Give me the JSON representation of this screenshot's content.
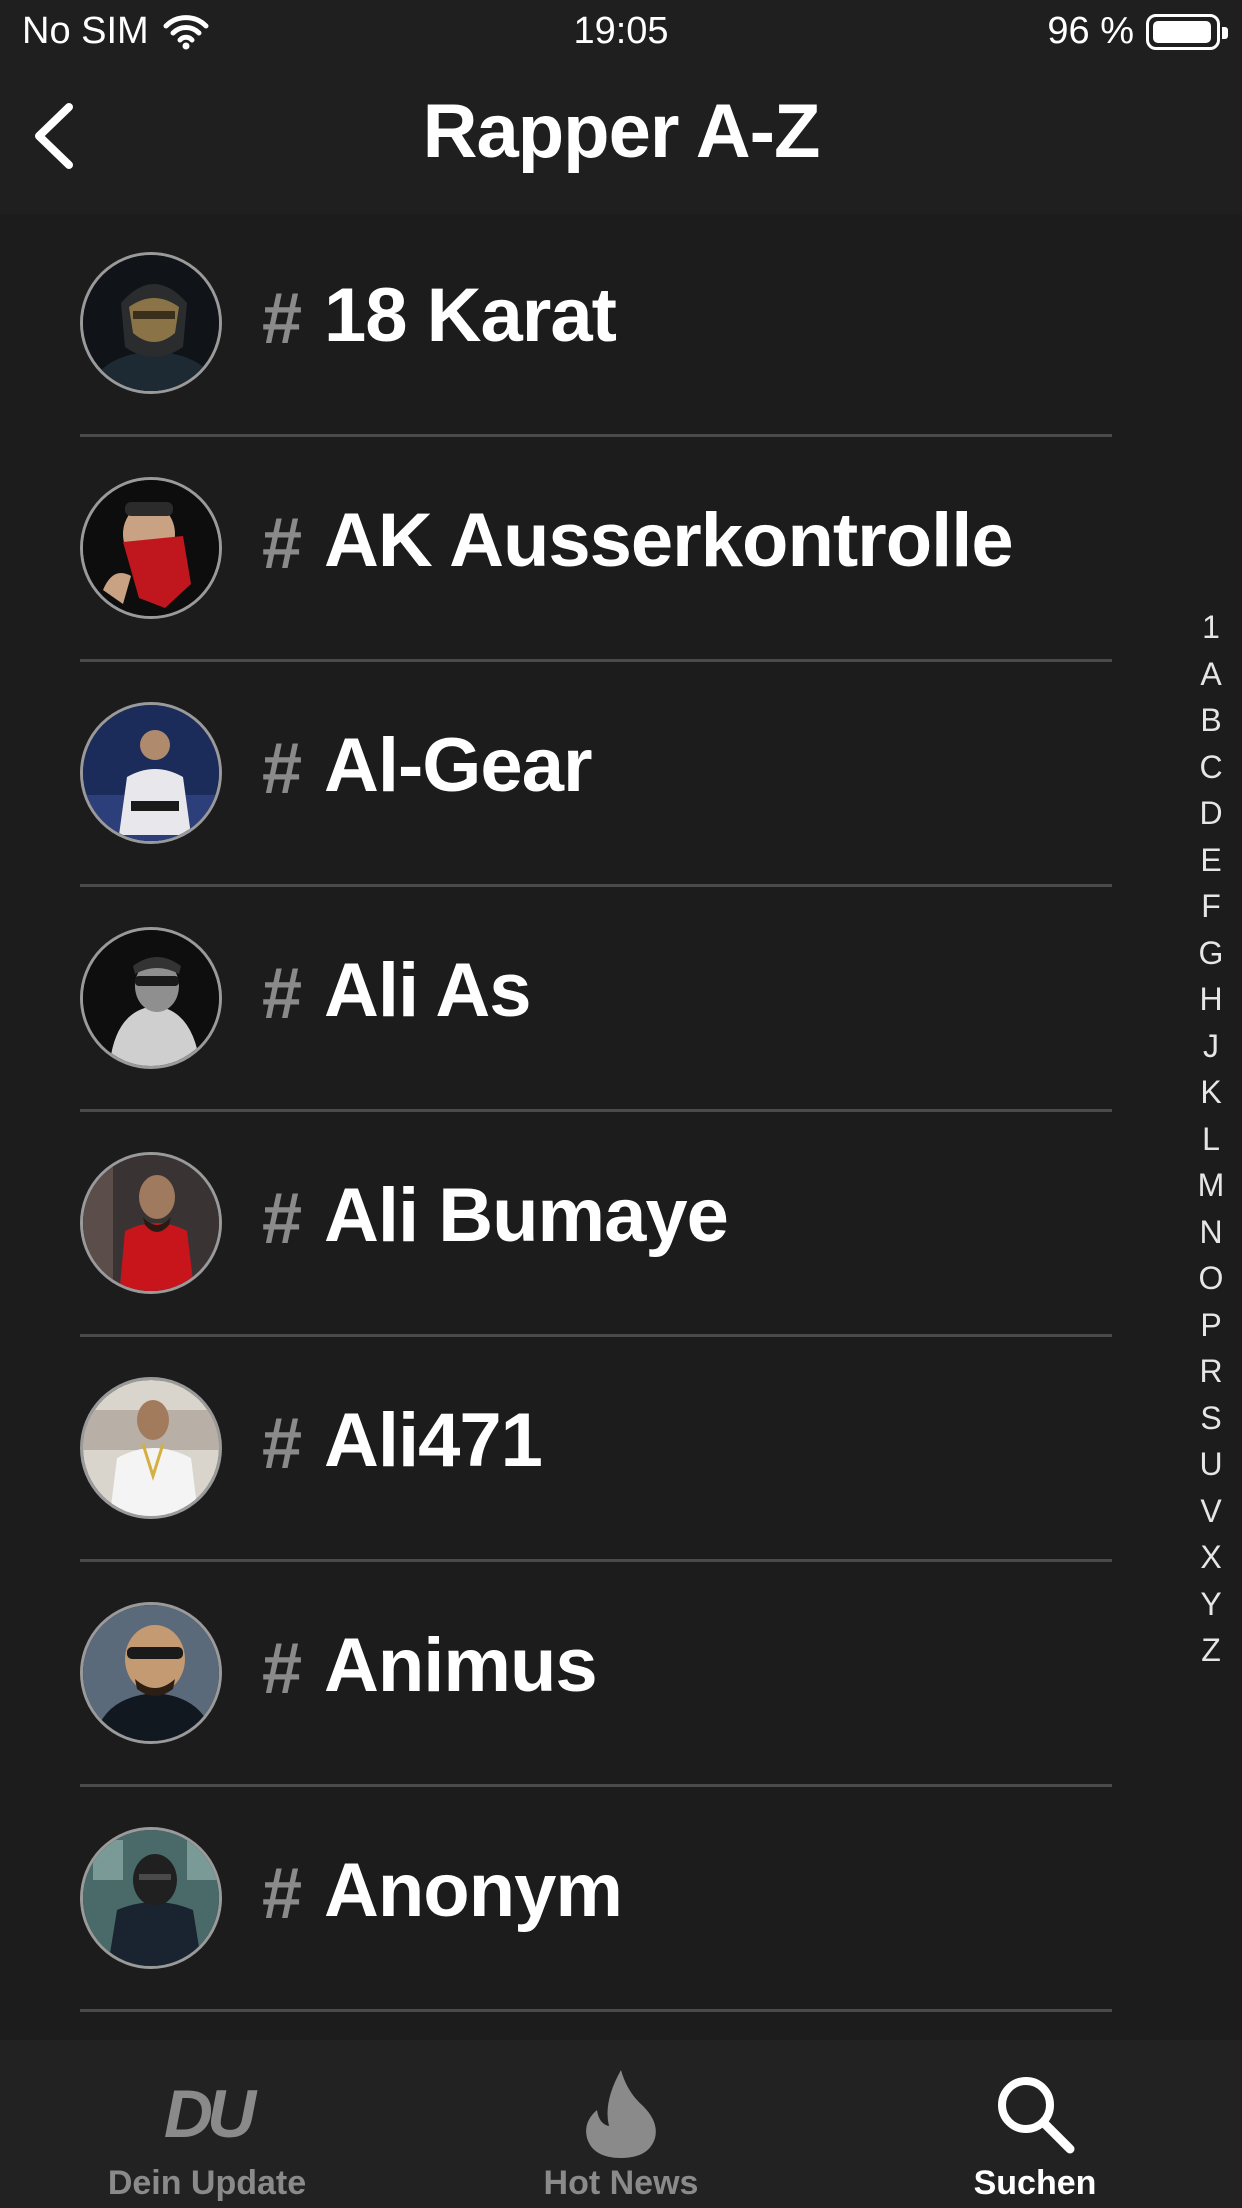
{
  "status": {
    "carrier": "No SIM",
    "time": "19:05",
    "battery": "96 %"
  },
  "nav": {
    "title": "Rapper A-Z"
  },
  "rows": [
    {
      "hash": "#",
      "name": "18 Karat"
    },
    {
      "hash": "#",
      "name": "AK Ausserkontrolle"
    },
    {
      "hash": "#",
      "name": "Al-Gear"
    },
    {
      "hash": "#",
      "name": "Ali As"
    },
    {
      "hash": "#",
      "name": "Ali Bumaye"
    },
    {
      "hash": "#",
      "name": "Ali471"
    },
    {
      "hash": "#",
      "name": "Animus"
    },
    {
      "hash": "#",
      "name": "Anonym"
    }
  ],
  "index": [
    "1",
    "A",
    "B",
    "C",
    "D",
    "E",
    "F",
    "G",
    "H",
    "J",
    "K",
    "L",
    "M",
    "N",
    "O",
    "P",
    "R",
    "S",
    "U",
    "V",
    "X",
    "Y",
    "Z"
  ],
  "tabs": [
    {
      "label": "Dein Update",
      "icon": "du-logo-icon",
      "logo_text": "DU"
    },
    {
      "label": "Hot News",
      "icon": "flame-icon"
    },
    {
      "label": "Suchen",
      "icon": "search-icon",
      "active": true
    }
  ],
  "colors": {
    "background": "#1c1c1c",
    "bar": "#1f1f1f",
    "divider": "#4a4a4a",
    "muted": "#8a8a8a"
  }
}
